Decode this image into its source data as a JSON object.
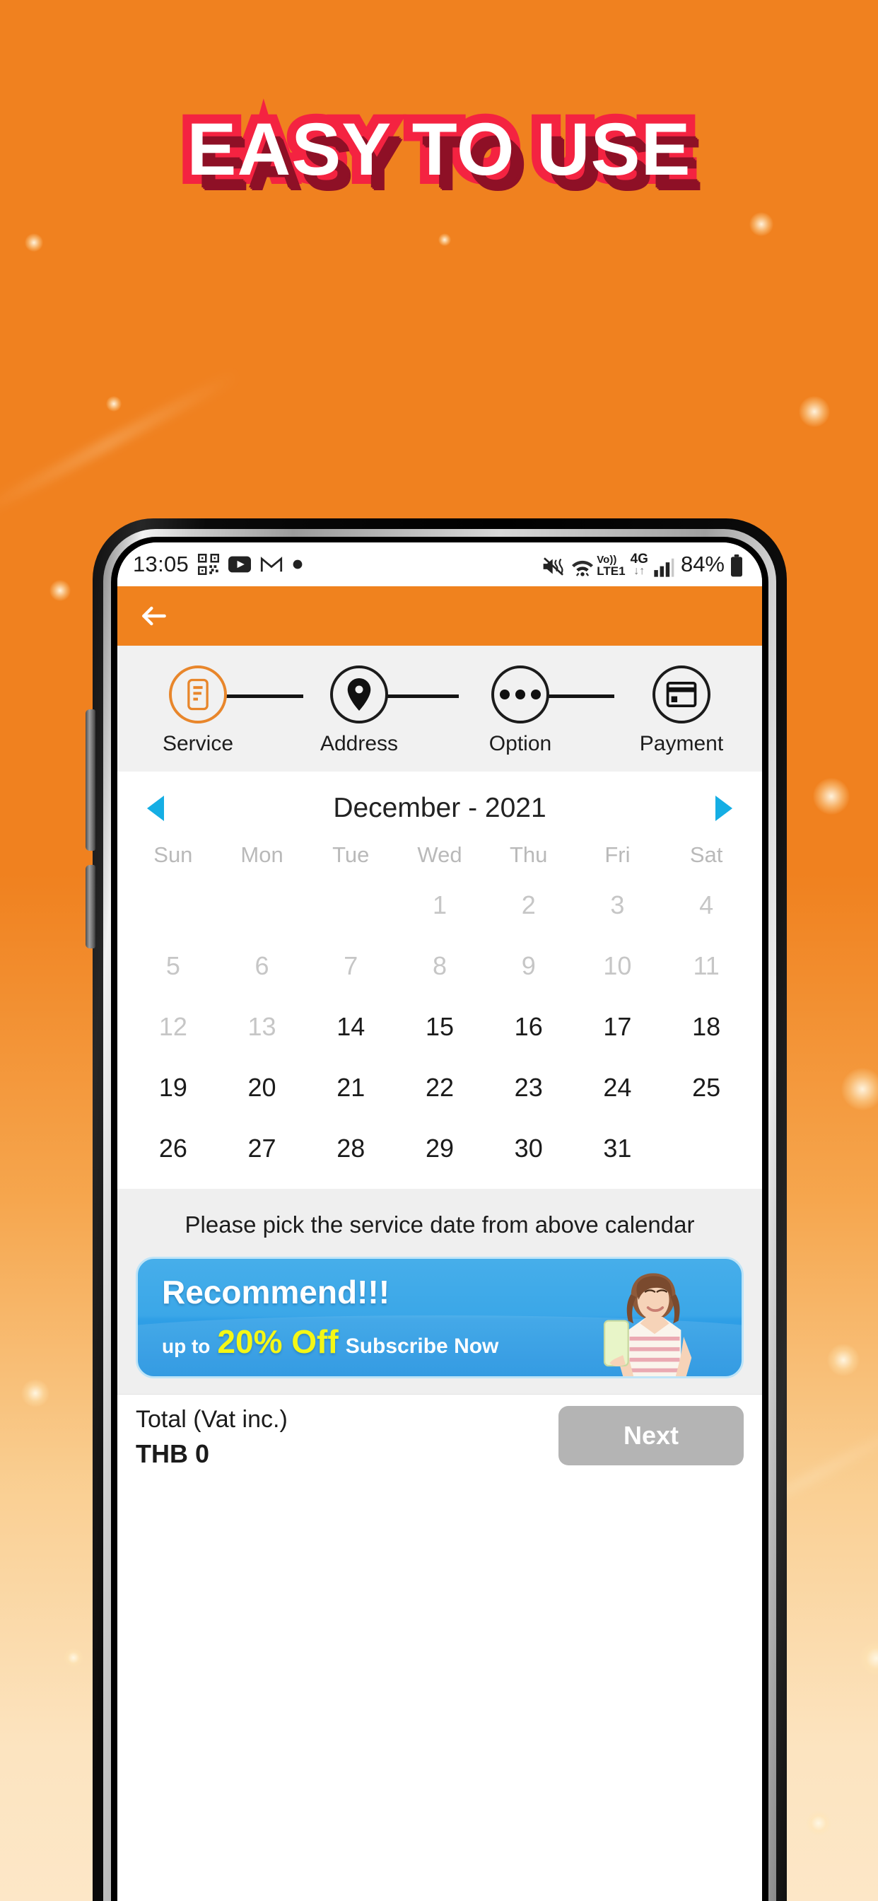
{
  "promo_headline": "EASY TO USE",
  "colors": {
    "background_orange": "#F0811F",
    "headline_fill": "#FFFFFF",
    "headline_outline": "#F42341",
    "headline_shadow": "#8E1026",
    "appbar_orange": "#F0821E",
    "active_step": "#E8862B",
    "calendar_arrow": "#15AEE4",
    "banner_blue": "#2F9FE6",
    "banner_yellow": "#F4F716",
    "next_button": "#B4B4B4"
  },
  "statusbar": {
    "time": "13:05",
    "left_icons": [
      "qr-code-icon",
      "youtube-icon",
      "gmail-icon",
      "dot-icon"
    ],
    "right_icons": [
      "mute-vibrate-icon",
      "wifi-volte-icon",
      "4g-data-icon",
      "signal-bars-icon"
    ],
    "volte_label": "Vo))",
    "lte_label": "LTE1",
    "network_label": "4G",
    "battery": "84%"
  },
  "appbar": {
    "back_icon": "back-arrow-icon"
  },
  "stepper": {
    "steps": [
      {
        "label": "Service",
        "icon": "service-document-icon",
        "active": true
      },
      {
        "label": "Address",
        "icon": "map-pin-icon",
        "active": false
      },
      {
        "label": "Option",
        "icon": "ellipsis-icon",
        "active": false
      },
      {
        "label": "Payment",
        "icon": "credit-card-icon",
        "active": false
      }
    ]
  },
  "calendar": {
    "prev_icon": "chevron-left-icon",
    "next_icon": "chevron-right-icon",
    "title": "December - 2021",
    "weekdays": [
      "Sun",
      "Mon",
      "Tue",
      "Wed",
      "Thu",
      "Fri",
      "Sat"
    ],
    "leading_blanks": 3,
    "days": [
      {
        "n": "1",
        "dim": true
      },
      {
        "n": "2",
        "dim": true
      },
      {
        "n": "3",
        "dim": true
      },
      {
        "n": "4",
        "dim": true
      },
      {
        "n": "5",
        "dim": true
      },
      {
        "n": "6",
        "dim": true
      },
      {
        "n": "7",
        "dim": true
      },
      {
        "n": "8",
        "dim": true
      },
      {
        "n": "9",
        "dim": true
      },
      {
        "n": "10",
        "dim": true
      },
      {
        "n": "11",
        "dim": true
      },
      {
        "n": "12",
        "dim": true
      },
      {
        "n": "13",
        "dim": true
      },
      {
        "n": "14",
        "dim": false
      },
      {
        "n": "15",
        "dim": false
      },
      {
        "n": "16",
        "dim": false
      },
      {
        "n": "17",
        "dim": false
      },
      {
        "n": "18",
        "dim": false
      },
      {
        "n": "19",
        "dim": false
      },
      {
        "n": "20",
        "dim": false
      },
      {
        "n": "21",
        "dim": false
      },
      {
        "n": "22",
        "dim": false
      },
      {
        "n": "23",
        "dim": false
      },
      {
        "n": "24",
        "dim": false
      },
      {
        "n": "25",
        "dim": false
      },
      {
        "n": "26",
        "dim": false
      },
      {
        "n": "27",
        "dim": false
      },
      {
        "n": "28",
        "dim": false
      },
      {
        "n": "29",
        "dim": false
      },
      {
        "n": "30",
        "dim": false
      },
      {
        "n": "31",
        "dim": false
      }
    ]
  },
  "hint": "Please pick the service date from above calendar",
  "promo_banner": {
    "title": "Recommend!!!",
    "prefix": "up to",
    "discount": "20% Off",
    "cta": "Subscribe Now"
  },
  "bottom": {
    "total_label": "Total (Vat inc.)",
    "total_value": "THB 0",
    "next_label": "Next"
  }
}
